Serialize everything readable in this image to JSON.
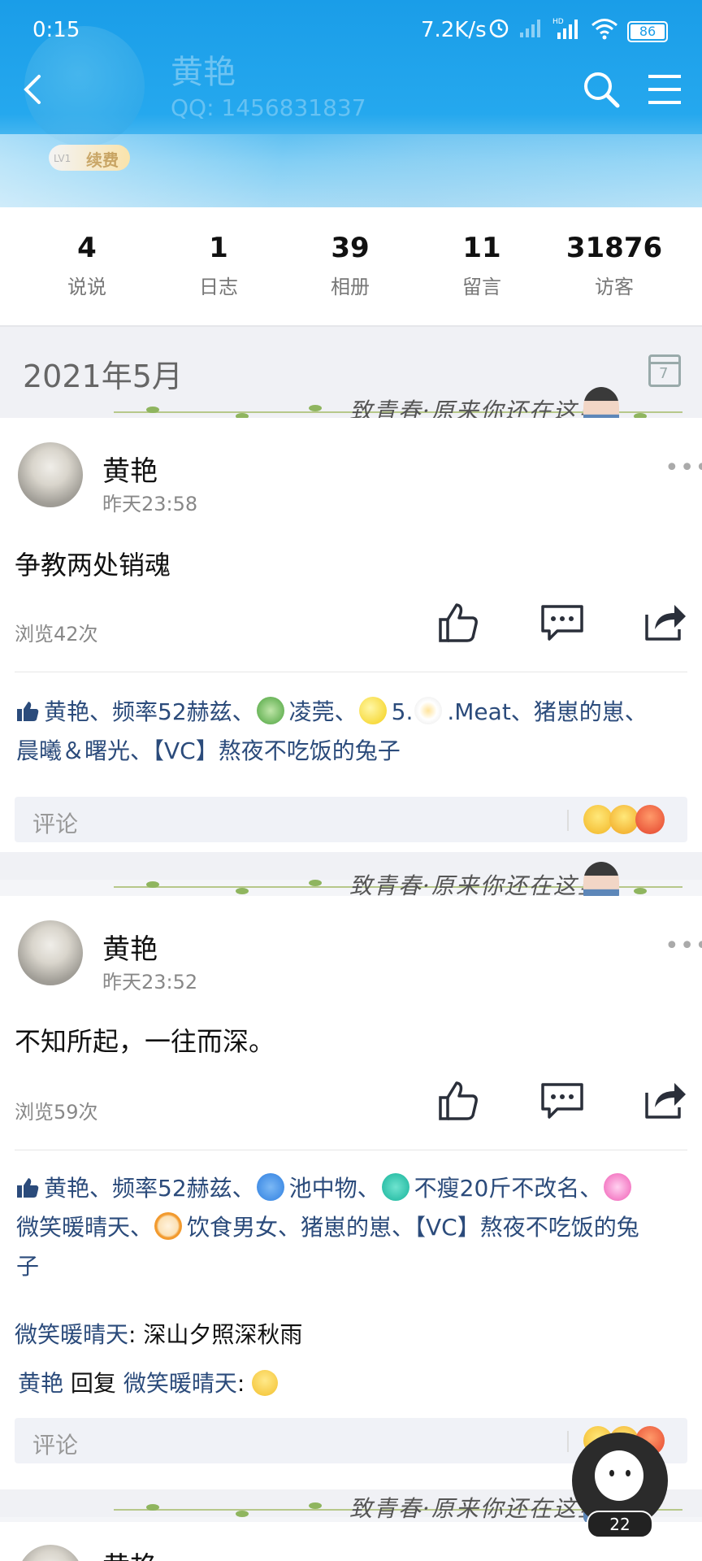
{
  "status_bar": {
    "time": "0:15",
    "network_speed": "7.2K/s",
    "battery": "86"
  },
  "profile": {
    "name": "黄艳",
    "qq": "QQ: 1456831837",
    "level": "LV1",
    "vip_label": "续费"
  },
  "stats": [
    {
      "value": "4",
      "label": "说说"
    },
    {
      "value": "1",
      "label": "日志"
    },
    {
      "value": "39",
      "label": "相册"
    },
    {
      "value": "11",
      "label": "留言"
    },
    {
      "value": "31876",
      "label": "访客"
    }
  ],
  "month": {
    "label": "2021年5月",
    "calendar_day": "7"
  },
  "banner": {
    "slogan": "致青春·原来你还在这里"
  },
  "posts": [
    {
      "author": "黄艳",
      "time": "昨天23:58",
      "text": "争教两处销魂",
      "views": "浏览42次",
      "likes_line1": "黄艳、频率52赫兹、",
      "likes_a": "凌莞、",
      "likes_b": "5.",
      "likes_c": ".Meat、猪崽的崽、",
      "likes_line2": "晨曦＆曙光、【VC】熬夜不吃饭的兔子",
      "comment_placeholder": "评论"
    },
    {
      "author": "黄艳",
      "time": "昨天23:52",
      "text": "不知所起，一往而深。",
      "views": "浏览59次",
      "likes_line1": "黄艳、频率52赫兹、",
      "likes_a": "池中物、",
      "likes_b": "不瘦20斤不改名、",
      "likes_line2a": "微笑暖晴天、",
      "likes_line2b": "饮食男女、猪崽的崽、【VC】熬夜不吃饭的兔",
      "likes_line3": "子",
      "comments": [
        {
          "user": "微笑暖晴天",
          "text": ": 深山夕照深秋雨"
        },
        {
          "user": "黄艳",
          "reply_word": "回复",
          "target": "微笑暖晴天",
          "text": ":"
        }
      ],
      "comment_placeholder": "评论"
    },
    {
      "author": "黄艳"
    }
  ],
  "floating_assistant": {
    "badge": "22"
  }
}
